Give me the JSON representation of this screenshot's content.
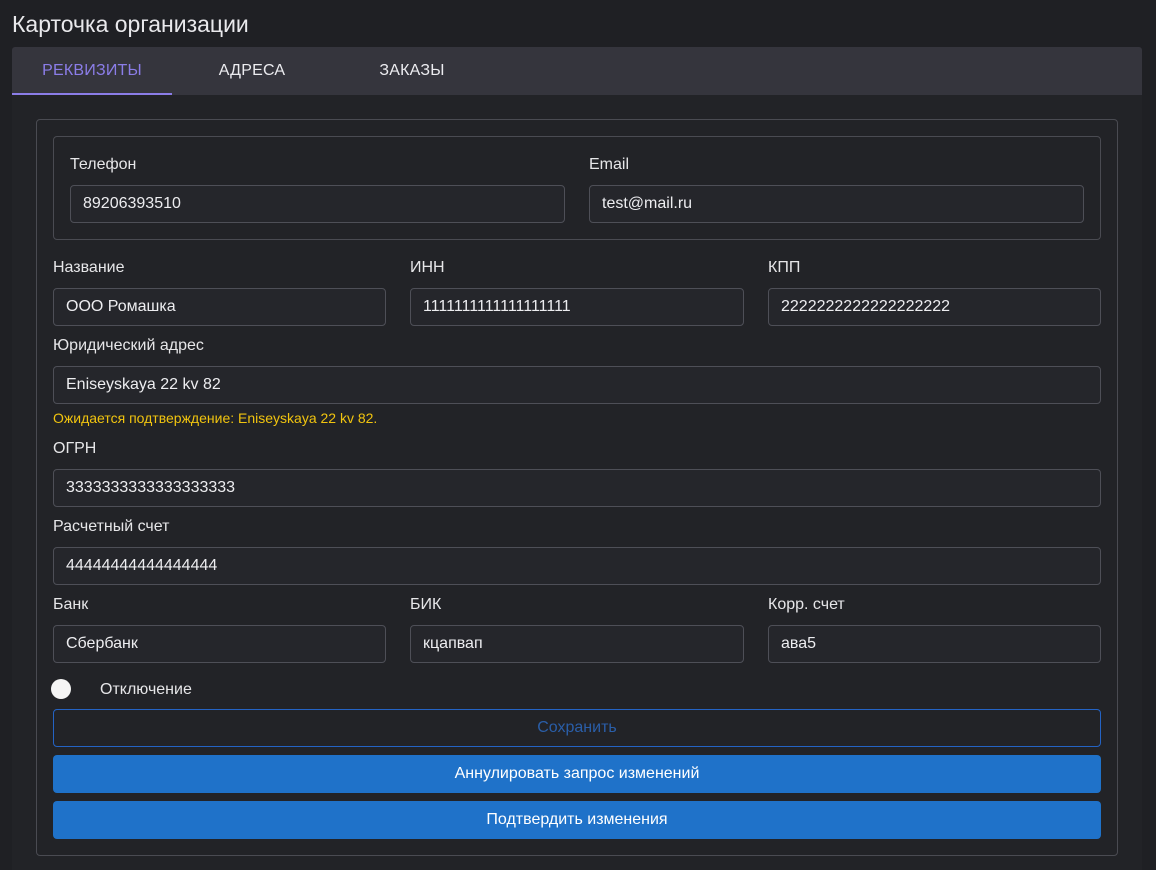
{
  "page": {
    "title": "Карточка организации"
  },
  "tabs": [
    {
      "label": "РЕКВИЗИТЫ",
      "active": true
    },
    {
      "label": "АДРЕСА",
      "active": false
    },
    {
      "label": "ЗАКАЗЫ",
      "active": false
    }
  ],
  "contacts": {
    "phone": {
      "label": "Телефон",
      "value": "89206393510"
    },
    "email": {
      "label": "Email",
      "value": "test@mail.ru"
    }
  },
  "org": {
    "name": {
      "label": "Название",
      "value": "ООО Ромашка"
    },
    "inn": {
      "label": "ИНН",
      "value": "1111111111111111111"
    },
    "kpp": {
      "label": "КПП",
      "value": "2222222222222222222"
    },
    "legal_address": {
      "label": "Юридический адрес",
      "value": "Eniseyskaya 22 kv 82",
      "pending_note": "Ожидается подтверждение: Eniseyskaya 22 kv 82."
    },
    "ogrn": {
      "label": "ОГРН",
      "value": "3333333333333333333"
    },
    "account": {
      "label": "Расчетный счет",
      "value": "44444444444444444"
    },
    "bank": {
      "label": "Банк",
      "value": "Сбербанк"
    },
    "bik": {
      "label": "БИК",
      "value": "кцапвап"
    },
    "corr_account": {
      "label": "Корр. счет",
      "value": "ава5"
    }
  },
  "disable_toggle": {
    "label": "Отключение",
    "on": false
  },
  "actions": {
    "save": "Сохранить",
    "cancel_request": "Аннулировать запрос изменений",
    "confirm": "Подтвердить изменения"
  },
  "colors": {
    "accent": "#8b7de8",
    "warning": "#f1c40f",
    "primary": "#1f72c9"
  }
}
